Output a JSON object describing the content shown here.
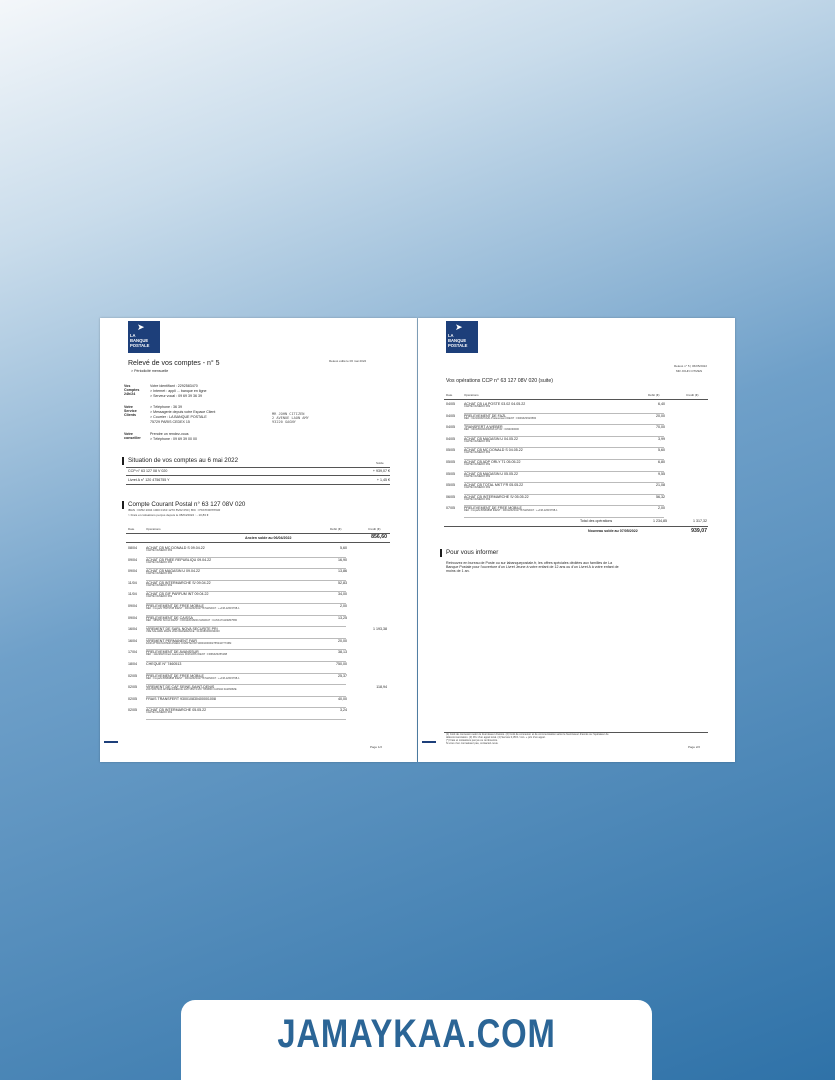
{
  "logo": {
    "line1": "LA",
    "line2": "BANQUE",
    "line3": "POSTALE"
  },
  "page1": {
    "releve_date": "Relevé édité le 06 mai 2022",
    "title": "Relevé de vos comptes - n° 5",
    "periodicity": "> Périodicité mensuelle",
    "contacts": [
      {
        "label": "Vos Comptes 24h/24",
        "lines": [
          "Votre identifiant : 2292583470",
          "> Internet : appli ... banque en ligne",
          "> Serveur vocal : 09 69 39 36 39"
        ]
      },
      {
        "label": "Votre Service Clients",
        "lines": [
          "> Téléphone : 36 39",
          "> Messagerie depuis votre Espace Client",
          "> Courrier : LA BANQUE POSTALE",
          "75729 PARIS CEDEX 15"
        ]
      },
      {
        "label": "Votre conseiller",
        "lines": [
          "Prendre un rendez-vous",
          "> Téléphone : 09 69 39 00 00"
        ]
      }
    ],
    "address": [
      "MR JOHN CITIZEN",
      "2 AVENUE LAON AMY",
      "93220 GAGNY"
    ],
    "situation_title": "Situation de vos comptes au 6 mai 2022",
    "situation_col": "Solde",
    "accounts": [
      {
        "name": "CCP n° 63 127 08 V 020",
        "balance": "+ 939,07 €"
      },
      {
        "name": "Livret A n° 120 4756755 Y",
        "balance": "+ 1,45 €"
      }
    ],
    "ccp_title": "Compte Courant Postal n° 63 127 08V 020",
    "ccp_iban": "IBAN : FR52 2004 1000 0163 1270 8V02 050 | BIC : PSSTFRPPPAR",
    "ccp_frais": "> Frais et cotisations perçus depuis le 08/04/2022 : - 10,83 €",
    "cols": {
      "date": "Date",
      "ops": "Opérations",
      "debit": "Débit (€)",
      "credit": "Crédit (€)"
    },
    "ancien_label": "Ancien solde au 06/04/2022",
    "ancien_value": "856,60",
    "ops": [
      {
        "date": "08/04",
        "label": "ACHAT CB MC DONALD S 09.04.22",
        "sub": "CARTE NUMERO 069",
        "debit": "5,60",
        "credit": ""
      },
      {
        "date": "09/04",
        "label": "ACHAT CB FNEE REPUBLIQU 09.04.22",
        "sub": "CARTE NUMERO 069",
        "debit": "16,90",
        "credit": ""
      },
      {
        "date": "09/04",
        "label": "ACHAT CB MAGASIN U 09.04.22",
        "sub": "CARTE NUMERO 069",
        "debit": "13,86",
        "credit": ""
      },
      {
        "date": "11/04",
        "label": "ACHAT CB INTERMARCHE S/ 09.04.22",
        "sub": "CARTE NUMERO 069",
        "debit": "52,83",
        "credit": ""
      },
      {
        "date": "11/04",
        "label": "ACHAT CB GIF PARFUM INT 09.04.22",
        "sub": "CARTE NUMERO 069",
        "debit": "34,00",
        "credit": ""
      },
      {
        "date": "09/04",
        "label": "PRELEVEMENT DE FREE MOBILE",
        "sub": "REF : FmpaN 75979708 IDENT : FR01ZZZ341778 MANDAT : ++FM-12615768-1",
        "debit": "2,00",
        "credit": ""
      },
      {
        "date": "09/04",
        "label": "PRELEVEMENT DE CAISSA",
        "sub": "REF : 985050 SCOA IDENT : FR01ZZ318231 MANDAT : CASS171119M07580",
        "debit": "13,25",
        "credit": ""
      },
      {
        "date": "16/04",
        "label": "VIREMENT DE SARL NOVA SECURITE PRI",
        "sub": "VRE SALAIRE MARS 2022 REFERENCE : 0141680000034000",
        "debit": "",
        "credit": "1 193,38"
      },
      {
        "date": "16/04",
        "label": "VIREMENT PERMANENT FAIR",
        "sub": "FAIR ATTRAYANTER ASARA COMPTE FR71000100000275534477746M",
        "debit": "20,00",
        "credit": ""
      },
      {
        "date": "17/04",
        "label": "PRELEVEMENT DE AVANSSUR",
        "sub": "REF : 111226M Direct Assurance 0016136S IDENT : FR66ZZZ255188",
        "debit": "38,13",
        "credit": ""
      },
      {
        "date": "18/04",
        "label": "CHEQUE N° 7460513",
        "sub": "",
        "debit": "750,00",
        "credit": ""
      },
      {
        "date": "02/05",
        "label": "PRELEVEMENT DE FREE MOBILE",
        "sub": "REF : FmpaN 80969898 IDENT : FR01ZZZ341778 MANDAT : ++FM-12615768-1",
        "debit": "25,37",
        "credit": ""
      },
      {
        "date": "02/05",
        "label": "VIREMENT DE CAF SEINE-SAINT-DENIS",
        "sub": "220718S7404 AP/REFERENCE 220718S74 MO 7950800 CAF93A 0A2818ME",
        "debit": "",
        "credit": "118,94"
      },
      {
        "date": "02/05",
        "label": "FRAIS TRANSFERT 930010830400001008",
        "sub": "",
        "debit": "40,00",
        "credit": ""
      },
      {
        "date": "02/05",
        "label": "ACHAT CB INTERMARCHE 05.05.22",
        "sub": "CARTE NUMERO 069",
        "debit": "3,24",
        "credit": ""
      }
    ],
    "pagenum": "Page 1/2"
  },
  "page2": {
    "releve_ref": "Relevé n° 5 | 06/05/2022",
    "releve_name": "MR JOHN CITIZEN",
    "title": "Vos opérations CCP n° 63 127 08V 020 (suite)",
    "cols": {
      "date": "Date",
      "ops": "Opérations",
      "debit": "Débit (€)",
      "credit": "Crédit (€)"
    },
    "ops": [
      {
        "date": "04/05",
        "label": "ACHAT CB LA POSTE 03.02 04.05.22",
        "sub": "CARTE NUMERO 069",
        "debit": "6,40",
        "credit": ""
      },
      {
        "date": "04/05",
        "label": "PRELEVEMENT DE FAZL",
        "sub": "REF : 0121023M FAZL Prelevement IDENT : FR46ZZZ323584",
        "debit": "20,00",
        "credit": ""
      },
      {
        "date": "04/05",
        "label": "TRANSFERT A WEBER",
        "sub": "REF : 0301059200160816 HTCR : 0334030000",
        "debit": "70,00",
        "credit": ""
      },
      {
        "date": "04/05",
        "label": "ACHAT CB MAGASIN U 04.05.22",
        "sub": "CARTE NUMERO 069",
        "debit": "3,99",
        "credit": ""
      },
      {
        "date": "05/05",
        "label": "ACHAT CB MC DONALD S 04.05.22",
        "sub": "CARTE NUMERO 069",
        "debit": "5,60",
        "credit": ""
      },
      {
        "date": "05/05",
        "label": "ACHAT CB ADP ORLY T1 05.05.22",
        "sub": "CARTE NUMERO 069",
        "debit": "6,80",
        "credit": ""
      },
      {
        "date": "05/05",
        "label": "ACHAT CB MAGASIN U 05.05.22",
        "sub": "CARTE NUMERO 069",
        "debit": "9,55",
        "credit": ""
      },
      {
        "date": "05/05",
        "label": "ACHAT CB TOTAL MKT FR 05.05.22",
        "sub": "CARTE NUMERO 069",
        "debit": "21,08",
        "credit": ""
      },
      {
        "date": "06/05",
        "label": "ACHAT CB INTERMARCHE S/ 05.05.22",
        "sub": "CARTE NUMERO 069",
        "debit": "56,32",
        "credit": ""
      },
      {
        "date": "07/05",
        "label": "PRELEVEMENT DE FREE MOBILE",
        "sub": "REF : FmpaN 80969898 IDENT : FR01ZZZ341778 MANDAT : ++FM-12615768-1",
        "debit": "2,00",
        "credit": ""
      }
    ],
    "total_label": "Total des opérations",
    "total_debit": "1 234,85",
    "total_credit": "1 317,32",
    "nouveau_label": "Nouveau solde au 07/05/2022",
    "nouveau_value": "939,07",
    "info_title": "Pour vous informer",
    "info_text": [
      "Retrouvez en bureau de Poste ou sur labanquepostale.fr, les offres spéciales dédiées aux familles de La",
      "Banque Postale pour l'ouverture d'un Livret Jeune à votre enfant de 12 ans ou d'un Livret A à votre enfant de",
      "moins de 1 an."
    ],
    "footnotes": [
      "(1) Coût de connexion selon le fournisseur d'accès. (2) Coût de connexion et de communication selon le fournisseur d'accès ou l'opérateur de",
      "télécommunication. (3) Prix d'un appel local. (4) Service 0,35 € / min. + prix d'un appel.",
      "(*) Frais et cotisations perçus ou rembourrés.",
      "Si vous n'en connaissez pas, contactez-nous."
    ],
    "pagenum": "Page 2/2"
  },
  "banner": {
    "text": "JAMAYKAA.COM"
  }
}
